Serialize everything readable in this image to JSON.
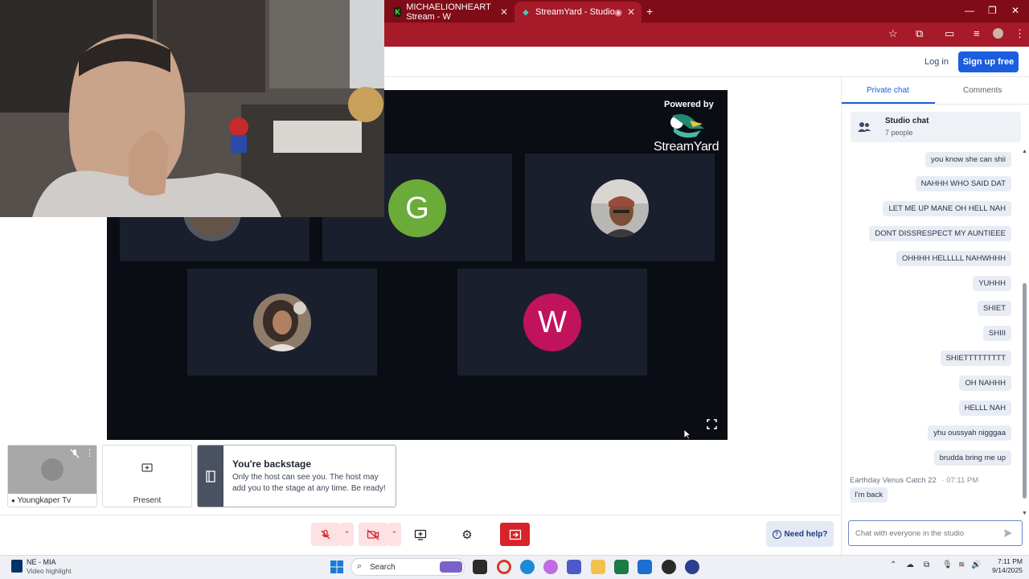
{
  "browser": {
    "tabs": [
      {
        "label": "MICHAELIONHEART Stream - W"
      },
      {
        "label": "StreamYard - Studio"
      }
    ]
  },
  "header": {
    "login_label": "Log in",
    "signup_label": "Sign up free"
  },
  "stage": {
    "powered_by": "Powered by",
    "logo_text": "StreamYard",
    "participants": [
      {
        "initial": "G",
        "color": "#6aab3a"
      },
      {
        "initial": "W",
        "color": "#c0135c"
      }
    ]
  },
  "bottom": {
    "self_name": "Youngkaper Tv",
    "present_label": "Present",
    "backstage_title": "You're backstage",
    "backstage_text": "Only the host can see you. The host may add you to the stage at any time. Be ready!",
    "need_help": "Need help?"
  },
  "chat": {
    "tabs": {
      "private": "Private chat",
      "comments": "Comments"
    },
    "studio_title": "Studio chat",
    "studio_count": "7 people",
    "messages": [
      "you know she can shii",
      "NAHHH WHO SAID DAT",
      "LET ME UP MANE OH HELL NAH",
      "DONT DISSRESPECT MY AUNTIEEE",
      "OHHHH HELLLLL NAHWHHH",
      "YUHHH",
      "SHIET",
      "SHIII",
      "SHIETTTTTTTTT",
      "OH NAHHH",
      "HELLL NAH",
      "yhu oussyah nigggaa",
      "brudda bring me up"
    ],
    "last_author": "Earthday Venus Catch 22",
    "last_time": "07:11 PM",
    "last_message": "I'm back",
    "input_placeholder": "Chat with everyone in the studio"
  },
  "taskbar": {
    "widget_title": "NE - MIA",
    "widget_sub": "Video highlight",
    "search_label": "Search",
    "time": "7:11 PM",
    "date": "9/14/2025"
  },
  "colors": {
    "browser_red": "#a61a2a",
    "primary_blue": "#1a5ede",
    "exit_red": "#d8232a"
  }
}
